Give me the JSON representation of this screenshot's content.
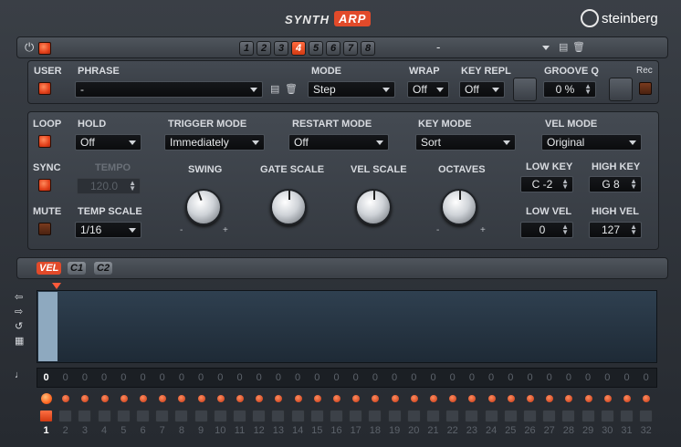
{
  "header": {
    "tab_synth": "SYNTH",
    "tab_arp": "ARP",
    "brand": "steinberg"
  },
  "pattern_bar": {
    "slots": [
      "1",
      "2",
      "3",
      "4",
      "5",
      "6",
      "7",
      "8"
    ],
    "active_slot": "4",
    "preset_name": "-"
  },
  "phrase_row": {
    "user_label": "USER",
    "phrase_label": "PHRASE",
    "phrase_value": "-",
    "mode_label": "MODE",
    "mode_value": "Step",
    "wrap_label": "WRAP",
    "wrap_value": "Off",
    "key_repl_label": "KEY REPL",
    "key_repl_value": "Off",
    "groove_q_label": "GROOVE Q",
    "groove_q_value": "0 %",
    "rec_label": "Rec"
  },
  "controls": {
    "loop_label": "LOOP",
    "hold_label": "HOLD",
    "hold_value": "Off",
    "trigger_mode_label": "TRIGGER MODE",
    "trigger_mode_value": "Immediately",
    "restart_mode_label": "RESTART MODE",
    "restart_mode_value": "Off",
    "key_mode_label": "KEY MODE",
    "key_mode_value": "Sort",
    "vel_mode_label": "VEL MODE",
    "vel_mode_value": "Original",
    "sync_label": "SYNC",
    "tempo_label": "TEMPO",
    "tempo_value": "120.0",
    "swing_label": "SWING",
    "gate_scale_label": "GATE SCALE",
    "vel_scale_label": "VEL SCALE",
    "octaves_label": "OCTAVES",
    "low_key_label": "LOW KEY",
    "low_key_value": "C -2",
    "high_key_label": "HIGH KEY",
    "high_key_value": "G 8",
    "mute_label": "MUTE",
    "temp_scale_label": "TEMP SCALE",
    "temp_scale_value": "1/16",
    "low_vel_label": "LOW VEL",
    "low_vel_value": "0",
    "high_vel_label": "HIGH VEL",
    "high_vel_value": "127",
    "knob_minus": "-",
    "knob_plus": "+"
  },
  "lanes": {
    "tabs": [
      "VEL",
      "C1",
      "C2"
    ],
    "active_tab": "VEL"
  },
  "steps": {
    "values": [
      "0",
      "0",
      "0",
      "0",
      "0",
      "0",
      "0",
      "0",
      "0",
      "0",
      "0",
      "0",
      "0",
      "0",
      "0",
      "0",
      "0",
      "0",
      "0",
      "0",
      "0",
      "0",
      "0",
      "0",
      "0",
      "0",
      "0",
      "0",
      "0",
      "0",
      "0",
      "0"
    ],
    "indices": [
      "1",
      "2",
      "3",
      "4",
      "5",
      "6",
      "7",
      "8",
      "9",
      "10",
      "11",
      "12",
      "13",
      "14",
      "15",
      "16",
      "17",
      "18",
      "19",
      "20",
      "21",
      "22",
      "23",
      "24",
      "25",
      "26",
      "27",
      "28",
      "29",
      "30",
      "31",
      "32"
    ]
  },
  "colors": {
    "accent": "#e3401a",
    "arp_tab": "#ff5a3a",
    "vel_bar": "#8ea9bf"
  }
}
